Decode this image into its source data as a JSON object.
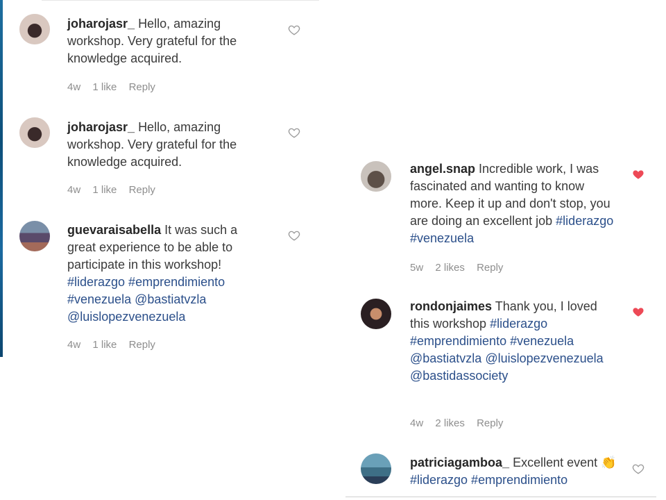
{
  "colors": {
    "liked_heart": "#ed4956",
    "unliked_heart": "#9a9a9a",
    "hashtag": "#2b4f8a",
    "meta_text": "#8e8e8e"
  },
  "left_comments": [
    {
      "username": "joharojasr_",
      "text": "Hello, amazing workshop. Very grateful for the knowledge acquired.",
      "time": "4w",
      "likes": "1 like",
      "reply": "Reply",
      "liked": false,
      "avatar_icon": "user-avatar"
    },
    {
      "username": "joharojasr_",
      "text": "Hello, amazing workshop. Very grateful for the knowledge acquired.",
      "time": "4w",
      "likes": "1 like",
      "reply": "Reply",
      "liked": false,
      "avatar_icon": "user-avatar"
    },
    {
      "username": "guevaraisabella",
      "text": "It was such a great experience to be able to participate in this workshop!",
      "tags": "#liderazgo #emprendimiento #venezuela @bastiatvzla @luislopezvenezuela",
      "time": "4w",
      "likes": "1 like",
      "reply": "Reply",
      "liked": false,
      "avatar_icon": "user-avatar"
    }
  ],
  "right_comments": [
    {
      "username": "angel.snap",
      "text": "Incredible work, I was fascinated and wanting to know more. Keep it up and don't stop, you are doing an excellent job",
      "tags": "#liderazgo #venezuela",
      "time": "5w",
      "likes": "2 likes",
      "reply": "Reply",
      "liked": true,
      "avatar_icon": "user-avatar"
    },
    {
      "username": "rondonjaimes",
      "text": "Thank you, I loved this workshop",
      "tags": "#liderazgo #emprendimiento #venezuela @bastiatvzla @luislopezvenezuela @bastidassociety",
      "time": "4w",
      "likes": "2 likes",
      "reply": "Reply",
      "liked": true,
      "avatar_icon": "user-avatar"
    },
    {
      "username": "patriciagamboa_",
      "text": "Excellent event",
      "emoji": "👏",
      "tags": "#liderazgo #emprendimiento",
      "liked": false,
      "avatar_icon": "user-avatar"
    }
  ]
}
